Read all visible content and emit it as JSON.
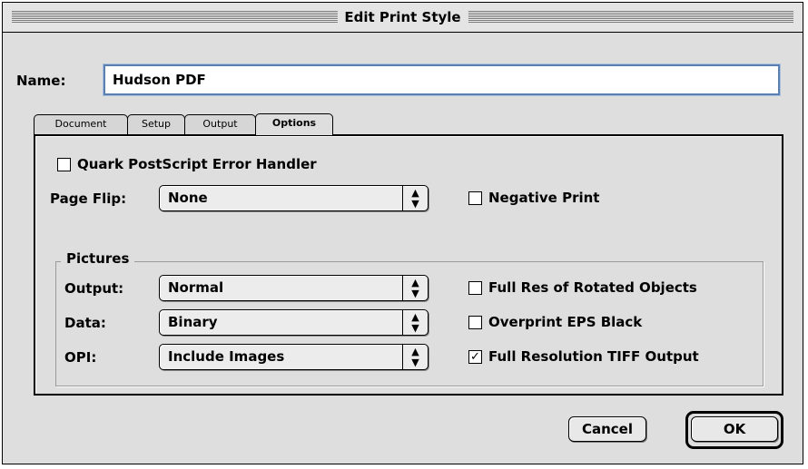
{
  "dialog": {
    "title": "Edit Print Style"
  },
  "name": {
    "label": "Name:",
    "value": "Hudson PDF"
  },
  "tabs": [
    {
      "label": "Document",
      "active": false
    },
    {
      "label": "Setup",
      "active": false
    },
    {
      "label": "Output",
      "active": false
    },
    {
      "label": "Options",
      "active": true
    }
  ],
  "options": {
    "error_handler": {
      "label": "Quark PostScript Error Handler",
      "checked": false
    },
    "page_flip": {
      "label": "Page Flip:",
      "value": "None"
    },
    "negative_print": {
      "label": "Negative Print",
      "checked": false
    },
    "pictures": {
      "title": "Pictures",
      "output": {
        "label": "Output:",
        "value": "Normal"
      },
      "data": {
        "label": "Data:",
        "value": "Binary"
      },
      "opi": {
        "label": "OPI:",
        "value": "Include Images"
      },
      "full_res_rotated": {
        "label": "Full Res of Rotated Objects",
        "checked": false
      },
      "overprint_eps": {
        "label": "Overprint EPS Black",
        "checked": false
      },
      "full_res_tiff": {
        "label": "Full Resolution TIFF Output",
        "checked": true
      }
    }
  },
  "popup_arrow_glyph": "▲\n▼",
  "check_glyph": "✓",
  "buttons": {
    "cancel": "Cancel",
    "ok": "OK"
  },
  "colors": {
    "window_bg": "#dedede",
    "focus_ring": "#5a7fb0"
  }
}
